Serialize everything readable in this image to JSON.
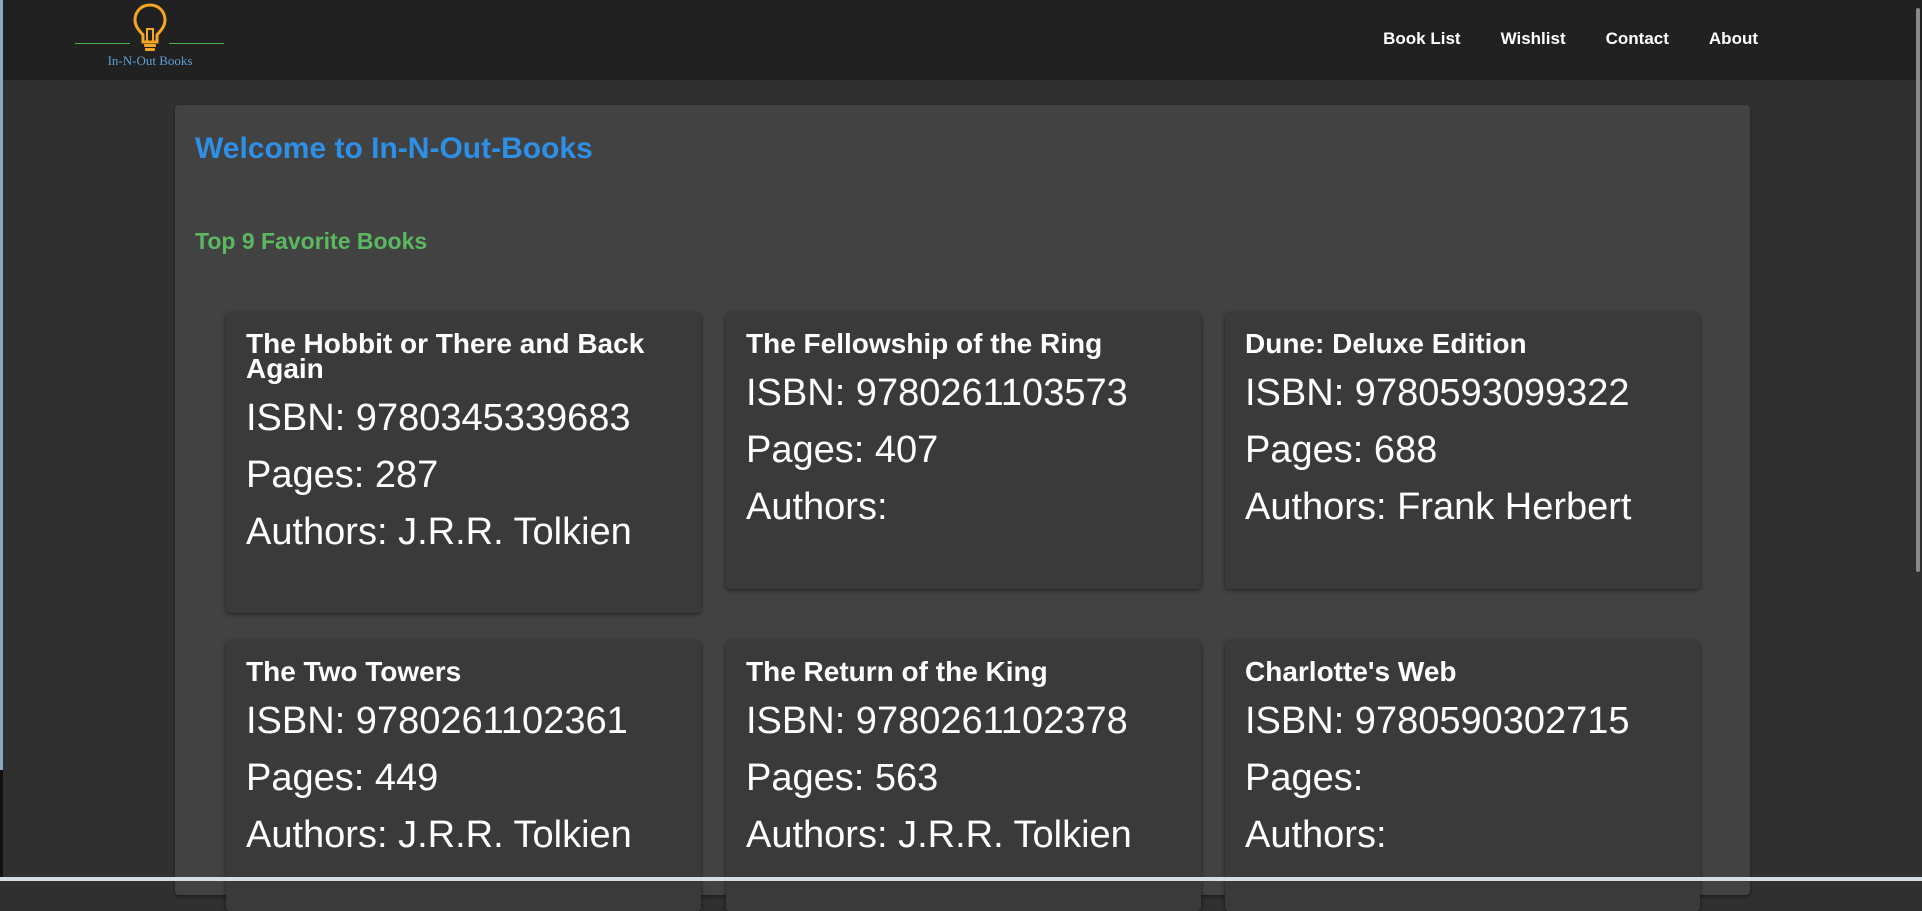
{
  "app": {
    "logo_text": "In-N-Out Books"
  },
  "nav": {
    "items": [
      {
        "label": "Book List"
      },
      {
        "label": "Wishlist"
      },
      {
        "label": "Contact"
      },
      {
        "label": "About"
      }
    ]
  },
  "main": {
    "title": "Welcome to In-N-Out-Books",
    "section_title": "Top 9 Favorite Books",
    "books": [
      {
        "title": "The Hobbit or There and Back Again",
        "isbn": "ISBN: 9780345339683",
        "pages": "Pages: 287",
        "authors": "Authors: J.R.R. Tolkien"
      },
      {
        "title": "The Fellowship of the Ring",
        "isbn": "ISBN: 9780261103573",
        "pages": "Pages: 407",
        "authors": "Authors:"
      },
      {
        "title": "Dune: Deluxe Edition",
        "isbn": "ISBN: 9780593099322",
        "pages": "Pages: 688",
        "authors": "Authors: Frank Herbert"
      },
      {
        "title": "The Two Towers",
        "isbn": "ISBN: 9780261102361",
        "pages": "Pages: 449",
        "authors": "Authors: J.R.R. Tolkien"
      },
      {
        "title": "The Return of the King",
        "isbn": "ISBN: 9780261102378",
        "pages": "Pages: 563",
        "authors": "Authors: J.R.R. Tolkien"
      },
      {
        "title": "Charlotte's Web",
        "isbn": "ISBN: 9780590302715",
        "pages": "Pages:",
        "authors": "Authors:"
      }
    ]
  },
  "colors": {
    "navbar": "#212121",
    "background": "#303030",
    "card": "#424242",
    "title_blue": "#2e8fe6",
    "section_green": "#5cb860",
    "logo_bulb": "#f5a623"
  },
  "icons": {
    "logo": "lightbulb-icon"
  }
}
